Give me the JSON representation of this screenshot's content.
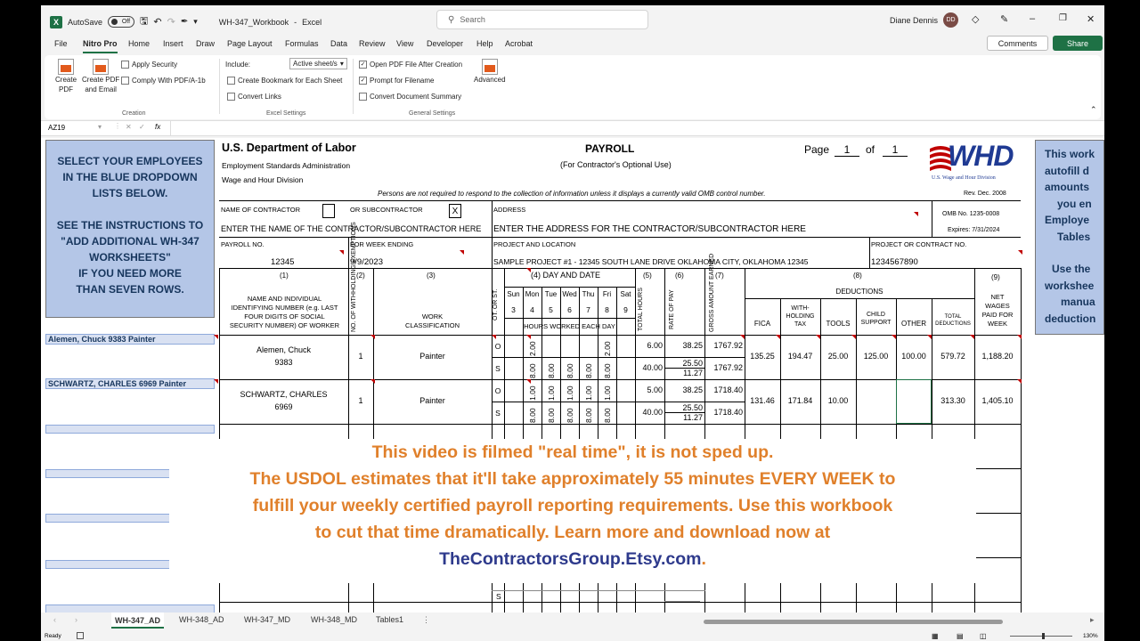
{
  "titlebar": {
    "autosave": "AutoSave",
    "toggle": "Off",
    "filename": "WH-347_Workbook",
    "app": "Excel",
    "search_placeholder": "Search",
    "user": "Diane Dennis",
    "initials": "DD"
  },
  "menu": {
    "items": [
      "File",
      "Nitro Pro",
      "Home",
      "Insert",
      "Draw",
      "Page Layout",
      "Formulas",
      "Data",
      "Review",
      "View",
      "Developer",
      "Help",
      "Acrobat"
    ],
    "comments": "Comments",
    "share": "Share"
  },
  "ribbon": {
    "create_pdf": [
      "Create",
      "PDF"
    ],
    "create_pdf_email": [
      "Create PDF",
      "and Email"
    ],
    "apply_security": "Apply Security",
    "comply": "Comply With PDF/A-1b",
    "creation": "Creation",
    "include": "Include:",
    "active_sheets": "Active sheet/s",
    "bookmark": "Create Bookmark for Each Sheet",
    "convert_links": "Convert Links",
    "excel_settings": "Excel Settings",
    "open_pdf": "Open PDF File After Creation",
    "prompt": "Prompt for Filename",
    "convert_summary": "Convert Document Summary",
    "general_settings": "General Settings",
    "advanced": "Advanced"
  },
  "formula": {
    "cell": "AZ19",
    "fx": "fx"
  },
  "left_box": [
    "SELECT YOUR EMPLOYEES",
    "IN THE BLUE DROPDOWN",
    "LISTS BELOW.",
    "",
    "SEE THE INSTRUCTIONS TO",
    "\"ADD ADDITIONAL WH-347",
    "WORKSHEETS\"",
    "IF YOU NEED MORE",
    "THAN SEVEN ROWS."
  ],
  "right_box": [
    "This work",
    "autofill d",
    "amounts",
    "you en",
    "Employe",
    "Tables",
    "",
    "Use the",
    "workshee",
    "manua",
    "deduction"
  ],
  "names": {
    "row1": "Alemen, Chuck 9383 Painter",
    "row2": "SCHWARTZ, CHARLES 6969 Painter"
  },
  "form": {
    "dept": "U.S. Department of Labor",
    "esa": "Employment Standards Administration",
    "whd": "Wage and Hour Division",
    "payroll": "PAYROLL",
    "optional": "(For Contractor's Optional Use)",
    "page": "Page",
    "page_no": "1",
    "of": "of",
    "page_total": "1",
    "logo": "WHD",
    "logo_sub": "U.S. Wage and Hour Division",
    "omb_notice": "Persons are not required to respond to the collection of information unless it displays a currently valid OMB control number.",
    "rev": "Rev. Dec. 2008",
    "name_contractor": "NAME OF CONTRACTOR",
    "or_sub": "OR SUBCONTRACTOR",
    "sub_mark": "X",
    "address": "ADDRESS",
    "omb_no": "OMB No. 1235-0008",
    "expires": "Expires: 7/31/2024",
    "enter_name": "ENTER THE NAME OF THE CONTRACTOR/SUBCONTRACTOR HERE",
    "enter_address": "ENTER THE ADDRESS FOR THE CONTRACTOR/SUBCONTRACTOR HERE",
    "payroll_no_lbl": "PAYROLL NO.",
    "week_ending_lbl": "FOR WEEK ENDING",
    "project_loc_lbl": "PROJECT AND LOCATION",
    "project_no_lbl": "PROJECT OR CONTRACT NO.",
    "payroll_no": "12345",
    "week_ending": "9/9/2023",
    "project_loc": "SAMPLE PROJECT #1 - 12345 SOUTH LANE DRIVE OKLAHOMA CITY, OKLAHOMA 12345",
    "project_no": "1234567890",
    "col1": "(1)",
    "col2": "(2)",
    "col3": "(3)",
    "col4": "(4) DAY AND DATE",
    "col5": "(5)",
    "col6": "(6)",
    "col7": "(7)",
    "col8": "(8)",
    "col9": "(9)",
    "name_hdr": [
      "NAME AND INDIVIDUAL",
      "IDENTIFYING NUMBER (e.g. LAST",
      "FOUR DIGITS OF SOCIAL",
      "SECURITY NUMBER) OF WORKER"
    ],
    "exemptions": "NO. OF WITHHOLDING EXEMPTIONS",
    "work_class": [
      "WORK",
      "CLASSIFICATION"
    ],
    "ot_st": "OT. OR ST.",
    "days": [
      "Sun",
      "Mon",
      "Tue",
      "Wed",
      "Thu",
      "Fri",
      "Sat"
    ],
    "dates": [
      "3",
      "4",
      "5",
      "6",
      "7",
      "8",
      "9"
    ],
    "hours_each_day": "HOURS WORKED EACH DAY",
    "total_hours": "TOTAL HOURS",
    "rate": "RATE OF PAY",
    "gross": "GROSS AMOUNT EARNED",
    "deductions": "DEDUCTIONS",
    "fica": "FICA",
    "withholding": [
      "WITH-",
      "HOLDING",
      "TAX"
    ],
    "tools": "TOOLS",
    "child": [
      "CHILD",
      "SUPPORT"
    ],
    "other": "OTHER",
    "total_ded": [
      "TOTAL",
      "DEDUCTIONS"
    ],
    "net": [
      "NET",
      "WAGES",
      "PAID FOR",
      "WEEK"
    ],
    "O": "O",
    "S": "S"
  },
  "employees": [
    {
      "name": "Alemen, Chuck",
      "id": "9383",
      "exemptions": "1",
      "class": "Painter",
      "ot_hours": [
        "",
        "2.00",
        "",
        "",
        "",
        "2.00",
        ""
      ],
      "st_hours": [
        "",
        "8.00",
        "8.00",
        "8.00",
        "8.00",
        "8.00",
        ""
      ],
      "ot_total": "6.00",
      "st_total": "40.00",
      "ot_rate": "38.25",
      "st_rate": "25.50",
      "fringe": "11.27",
      "ot_gross": "1767.92",
      "st_gross": "1767.92",
      "fica": "135.25",
      "wh": "194.47",
      "tools": "25.00",
      "child": "125.00",
      "other": "100.00",
      "total_ded": "579.72",
      "net": "1,188.20"
    },
    {
      "name": "SCHWARTZ, CHARLES",
      "id": "6969",
      "exemptions": "1",
      "class": "Painter",
      "ot_hours": [
        "",
        "1.00",
        "1.00",
        "1.00",
        "1.00",
        "1.00",
        ""
      ],
      "st_hours": [
        "",
        "8.00",
        "8.00",
        "8.00",
        "8.00",
        "8.00",
        ""
      ],
      "ot_total": "5.00",
      "st_total": "40.00",
      "ot_rate": "38.25",
      "st_rate": "25.50",
      "fringe": "11.27",
      "ot_gross": "1718.40",
      "st_gross": "1718.40",
      "fica": "131.46",
      "wh": "171.84",
      "tools": "10.00",
      "child": "",
      "other": "",
      "total_ded": "313.30",
      "net": "1,405.10"
    }
  ],
  "overlay": {
    "line1": "This video is filmed \"real time\", it is not sped up.",
    "line2": "The USDOL estimates that it'll take approximately 55 minutes EVERY WEEK to",
    "line3": "fulfill your weekly certified payroll reporting requirements. Use this workbook",
    "line4": "to cut that time dramatically. Learn more and download now at",
    "link": "TheContractorsGroup.Etsy.com",
    "period": "."
  },
  "tabs": [
    "WH-347_AD",
    "WH-348_AD",
    "WH-347_MD",
    "WH-348_MD",
    "Tables1"
  ],
  "status": {
    "ready": "Ready",
    "zoom": "130%"
  },
  "colors": {
    "excel_green": "#1e7145",
    "blue_box": "#b4c6e7",
    "overlay_orange": "#e0802b",
    "overlay_link": "#2e3a8c"
  }
}
